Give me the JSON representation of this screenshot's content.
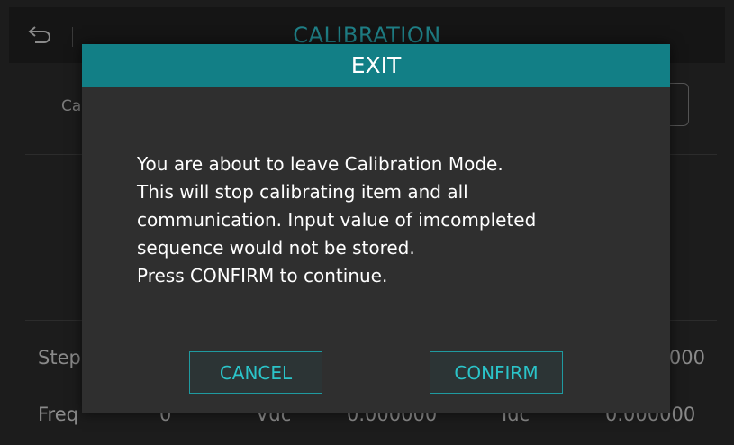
{
  "app": {
    "title": "CALIBRATION",
    "back_icon": "back-arrow-icon",
    "calibration_label_partial": "Ca",
    "step_label_partial": "Step",
    "step_value_partial": "000",
    "freq_row": {
      "freq_label_partial": "Freq",
      "freq_value": "0",
      "vdc_label": "Vdc",
      "vdc_value": "0.000000",
      "idc_label": "Idc",
      "idc_value": "0.000000"
    }
  },
  "dialog": {
    "title": "EXIT",
    "message_lines": [
      "You are about to leave Calibration Mode.",
      "This will stop calibrating item and all",
      "communication. Input value of imcompleted",
      "sequence would not be stored.",
      "Press CONFIRM to continue."
    ],
    "cancel_label": "CANCEL",
    "confirm_label": "CONFIRM"
  },
  "colors": {
    "header_teal": "#127f86",
    "button_text": "#2bc4c9",
    "dialog_bg": "#2f2f2f",
    "screen_bg": "#1c1c1c"
  }
}
